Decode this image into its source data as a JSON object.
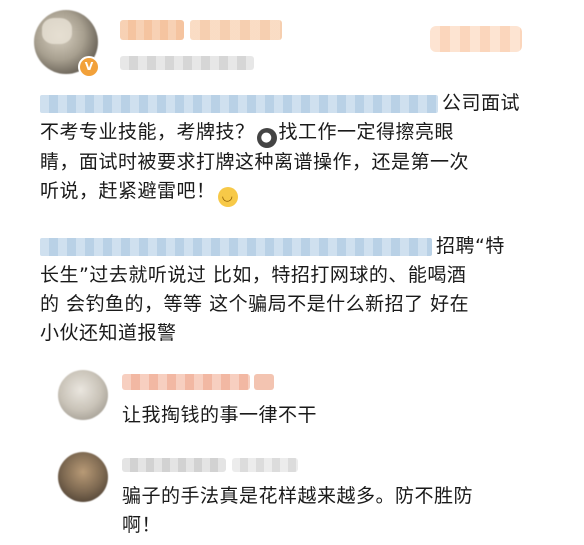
{
  "header": {
    "verified_mark": "V"
  },
  "comments": [
    {
      "line1_tail": "公司面试",
      "line2_a": "不考专业技能，考牌技？",
      "line2_b": "找工作一定得擦亮眼",
      "line3": "睛，面试时被要求打牌这种离谱操作，还是第一次",
      "line4": "听说，赶紧避雷吧！"
    },
    {
      "line1_tail": "招聘“特",
      "line2": "长生”过去就听说过 比如，特招打网球的、能喝酒",
      "line3": "的 会钓鱼的，等等 这个骗局不是什么新招了 好在",
      "line4": "小伙还知道报警"
    }
  ],
  "replies": [
    {
      "text": "让我掏钱的事一律不干"
    },
    {
      "line1": "骗子的手法真是花样越来越多。防不胜防",
      "line2": "啊！"
    }
  ],
  "icons": {
    "emoji_1": "eyes-emoji-icon",
    "emoji_2": "smile-emoji-icon"
  }
}
